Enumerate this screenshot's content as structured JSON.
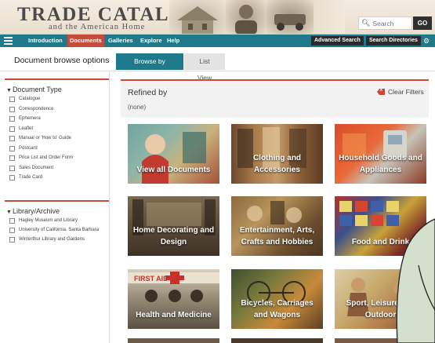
{
  "header": {
    "logo_title": "TRADE CATALOGUES",
    "logo_subtitle": "and the American Home",
    "search": {
      "placeholder": "Search",
      "go_label": "GO"
    }
  },
  "nav": {
    "items": [
      "Introduction",
      "Documents",
      "Galleries",
      "Explore",
      "Help"
    ],
    "active": "Documents",
    "right_buttons": [
      "Advanced Search",
      "Search Directories"
    ]
  },
  "options_bar": {
    "title": "Document browse options",
    "tabs": [
      "Browse by Industry",
      "List View"
    ],
    "active_tab": "Browse by Industry"
  },
  "sidebar": {
    "document_type": {
      "title": "Document Type",
      "options": [
        "Catalogue",
        "Correspondence",
        "Ephemera",
        "Leaflet",
        "Manual or 'How to' Guide",
        "Postcard",
        "Price List and Order Form",
        "Sales Document",
        "Trade Card"
      ]
    },
    "library": {
      "title": "Library/Archive",
      "options": [
        "Hagley Museum and Library",
        "University of California, Santa Barbara",
        "Winterthur Library and Gardens"
      ]
    }
  },
  "refined": {
    "title": "Refined by",
    "value": "(none)",
    "clear_label": "Clear Filters"
  },
  "tiles": [
    {
      "label": "View all Documents"
    },
    {
      "label": "Clothing and Accessories"
    },
    {
      "label": "Household Goods and Appliances"
    },
    {
      "label": "Home Decorating and Design"
    },
    {
      "label": "Entertainment, Arts, Crafts and Hobbies"
    },
    {
      "label": "Food and Drink"
    },
    {
      "label": "Health and Medicine"
    },
    {
      "label": "Bicycles, Carriages and Wagons"
    },
    {
      "label": "Sport, Leisure and Outdoor"
    }
  ],
  "tile_image_texts": {
    "health_sign": "FIRST AID"
  },
  "colors": {
    "nav_bg": "#1e7a8a",
    "accent_red": "#c64b38",
    "header_bg": "#f4ece0",
    "bubble_fill": "#d3e0cb"
  },
  "icons": [
    "hamburger-icon",
    "search-icon",
    "gear-icon",
    "triangle-down-icon",
    "clear-filter-icon"
  ]
}
